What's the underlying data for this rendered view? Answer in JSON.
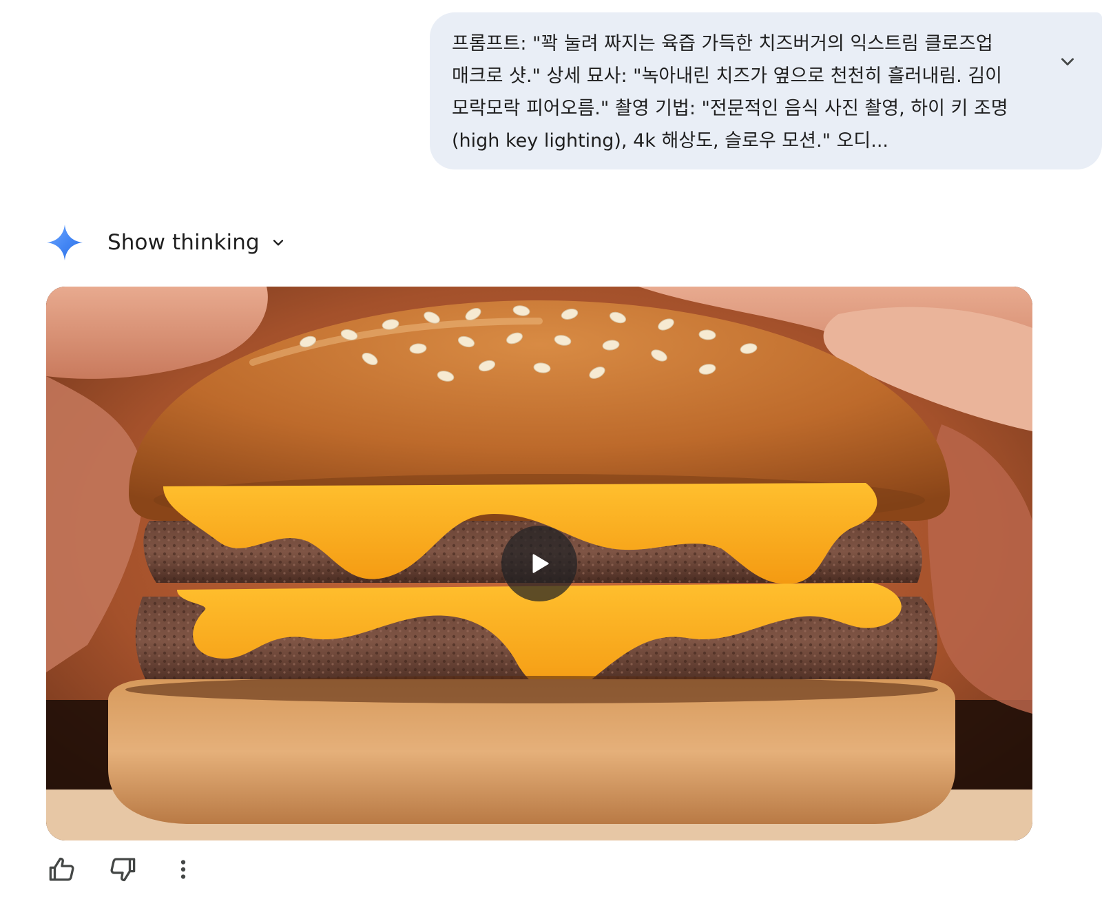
{
  "prompt": {
    "text": "프롬프트: \"꽉 눌려 짜지는 육즙 가득한 치즈버거의 익스트림 클로즈업 매크로 샷.\" 상세 묘사: \"녹아내린 치즈가 옆으로 천천히 흘러내림. 김이 모락모락 피어오름.\" 촬영 기법: \"전문적인 음식 사진 촬영, 하이 키 조명(high key lighting), 4k 해상도, 슬로우 모션.\" 오디...",
    "expand_icon": "chevron-down-icon"
  },
  "response": {
    "logo_icon": "gemini-sparkle-icon",
    "show_thinking_label": "Show thinking",
    "show_thinking_icon": "chevron-down-icon"
  },
  "video": {
    "subject": "cheeseburger",
    "play_icon": "play-icon"
  },
  "actions": {
    "like_icon": "thumb-up-icon",
    "dislike_icon": "thumb-down-icon",
    "more_icon": "more-vert-icon"
  },
  "colors": {
    "prompt_bubble_bg": "#e9eef6",
    "text": "#1f1f1f",
    "icon": "#444746",
    "gemini_blue": "#4285f4",
    "gemini_blue_light": "#6fa8ff"
  }
}
